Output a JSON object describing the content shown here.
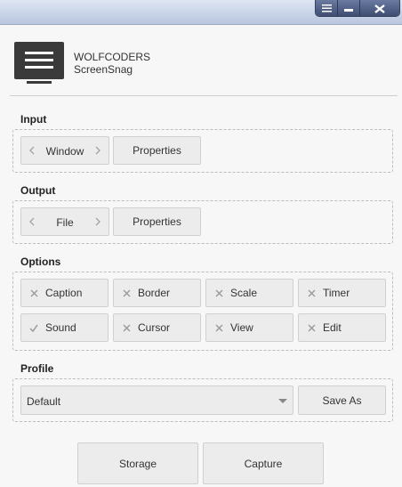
{
  "window": {
    "menu_icon": "menu-icon",
    "minimize_icon": "minimize-icon",
    "close_icon": "close-icon"
  },
  "header": {
    "logo_icon": "monitor-menu-icon",
    "company": "WOLFCODERS",
    "product": "ScreenSnag"
  },
  "input": {
    "label": "Input",
    "selector_value": "Window",
    "properties_label": "Properties"
  },
  "output": {
    "label": "Output",
    "selector_value": "File",
    "properties_label": "Properties"
  },
  "options": {
    "label": "Options",
    "items": [
      {
        "label": "Caption",
        "checked": false
      },
      {
        "label": "Border",
        "checked": false
      },
      {
        "label": "Scale",
        "checked": false
      },
      {
        "label": "Timer",
        "checked": false
      },
      {
        "label": "Sound",
        "checked": true
      },
      {
        "label": "Cursor",
        "checked": false
      },
      {
        "label": "View",
        "checked": false
      },
      {
        "label": "Edit",
        "checked": false
      }
    ]
  },
  "profile": {
    "label": "Profile",
    "selected": "Default",
    "save_as_label": "Save As"
  },
  "footer": {
    "storage_label": "Storage",
    "capture_label": "Capture"
  },
  "colors": {
    "titlebar": "#c9d4e8",
    "button_bg": "#ececec",
    "dark": "#3a3a3a"
  }
}
